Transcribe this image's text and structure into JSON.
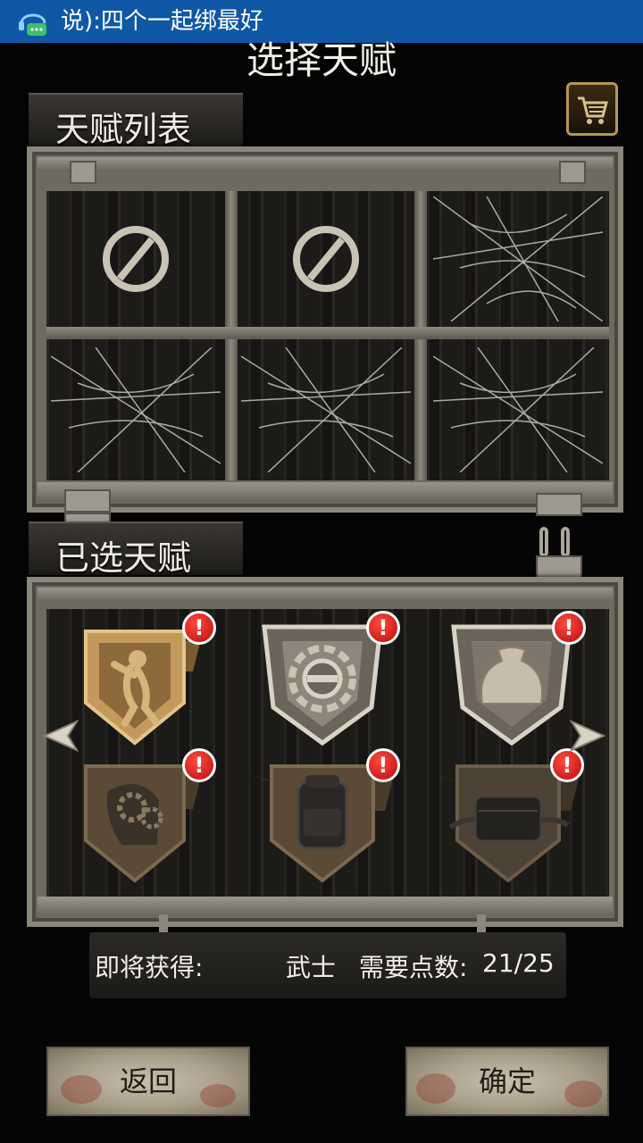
{
  "notification": {
    "text": "说):四个一起绑最好"
  },
  "page": {
    "title": "选择天赋"
  },
  "talent_list": {
    "label": "天赋列表",
    "slots": [
      "locked",
      "locked",
      "empty",
      "empty",
      "empty",
      "empty"
    ]
  },
  "selected_talents": {
    "label": "已选天赋",
    "items": [
      {
        "icon": "figure-icon",
        "alert": "!"
      },
      {
        "icon": "gear-shield-icon",
        "alert": "!"
      },
      {
        "icon": "sack-icon",
        "alert": "!"
      },
      {
        "icon": "gears-head-icon",
        "alert": "!"
      },
      {
        "icon": "backpack-icon",
        "alert": "!"
      },
      {
        "icon": "waist-bag-icon",
        "alert": "!"
      }
    ]
  },
  "info": {
    "obtain_label": "即将获得:",
    "class_name": "武士",
    "points_label": "需要点数:",
    "points_value": "21/25"
  },
  "buttons": {
    "back": "返回",
    "confirm": "确定"
  },
  "colors": {
    "notification_bar": "#0e58a6",
    "alert": "#d81818",
    "badge_gold": "#c49a5c"
  }
}
